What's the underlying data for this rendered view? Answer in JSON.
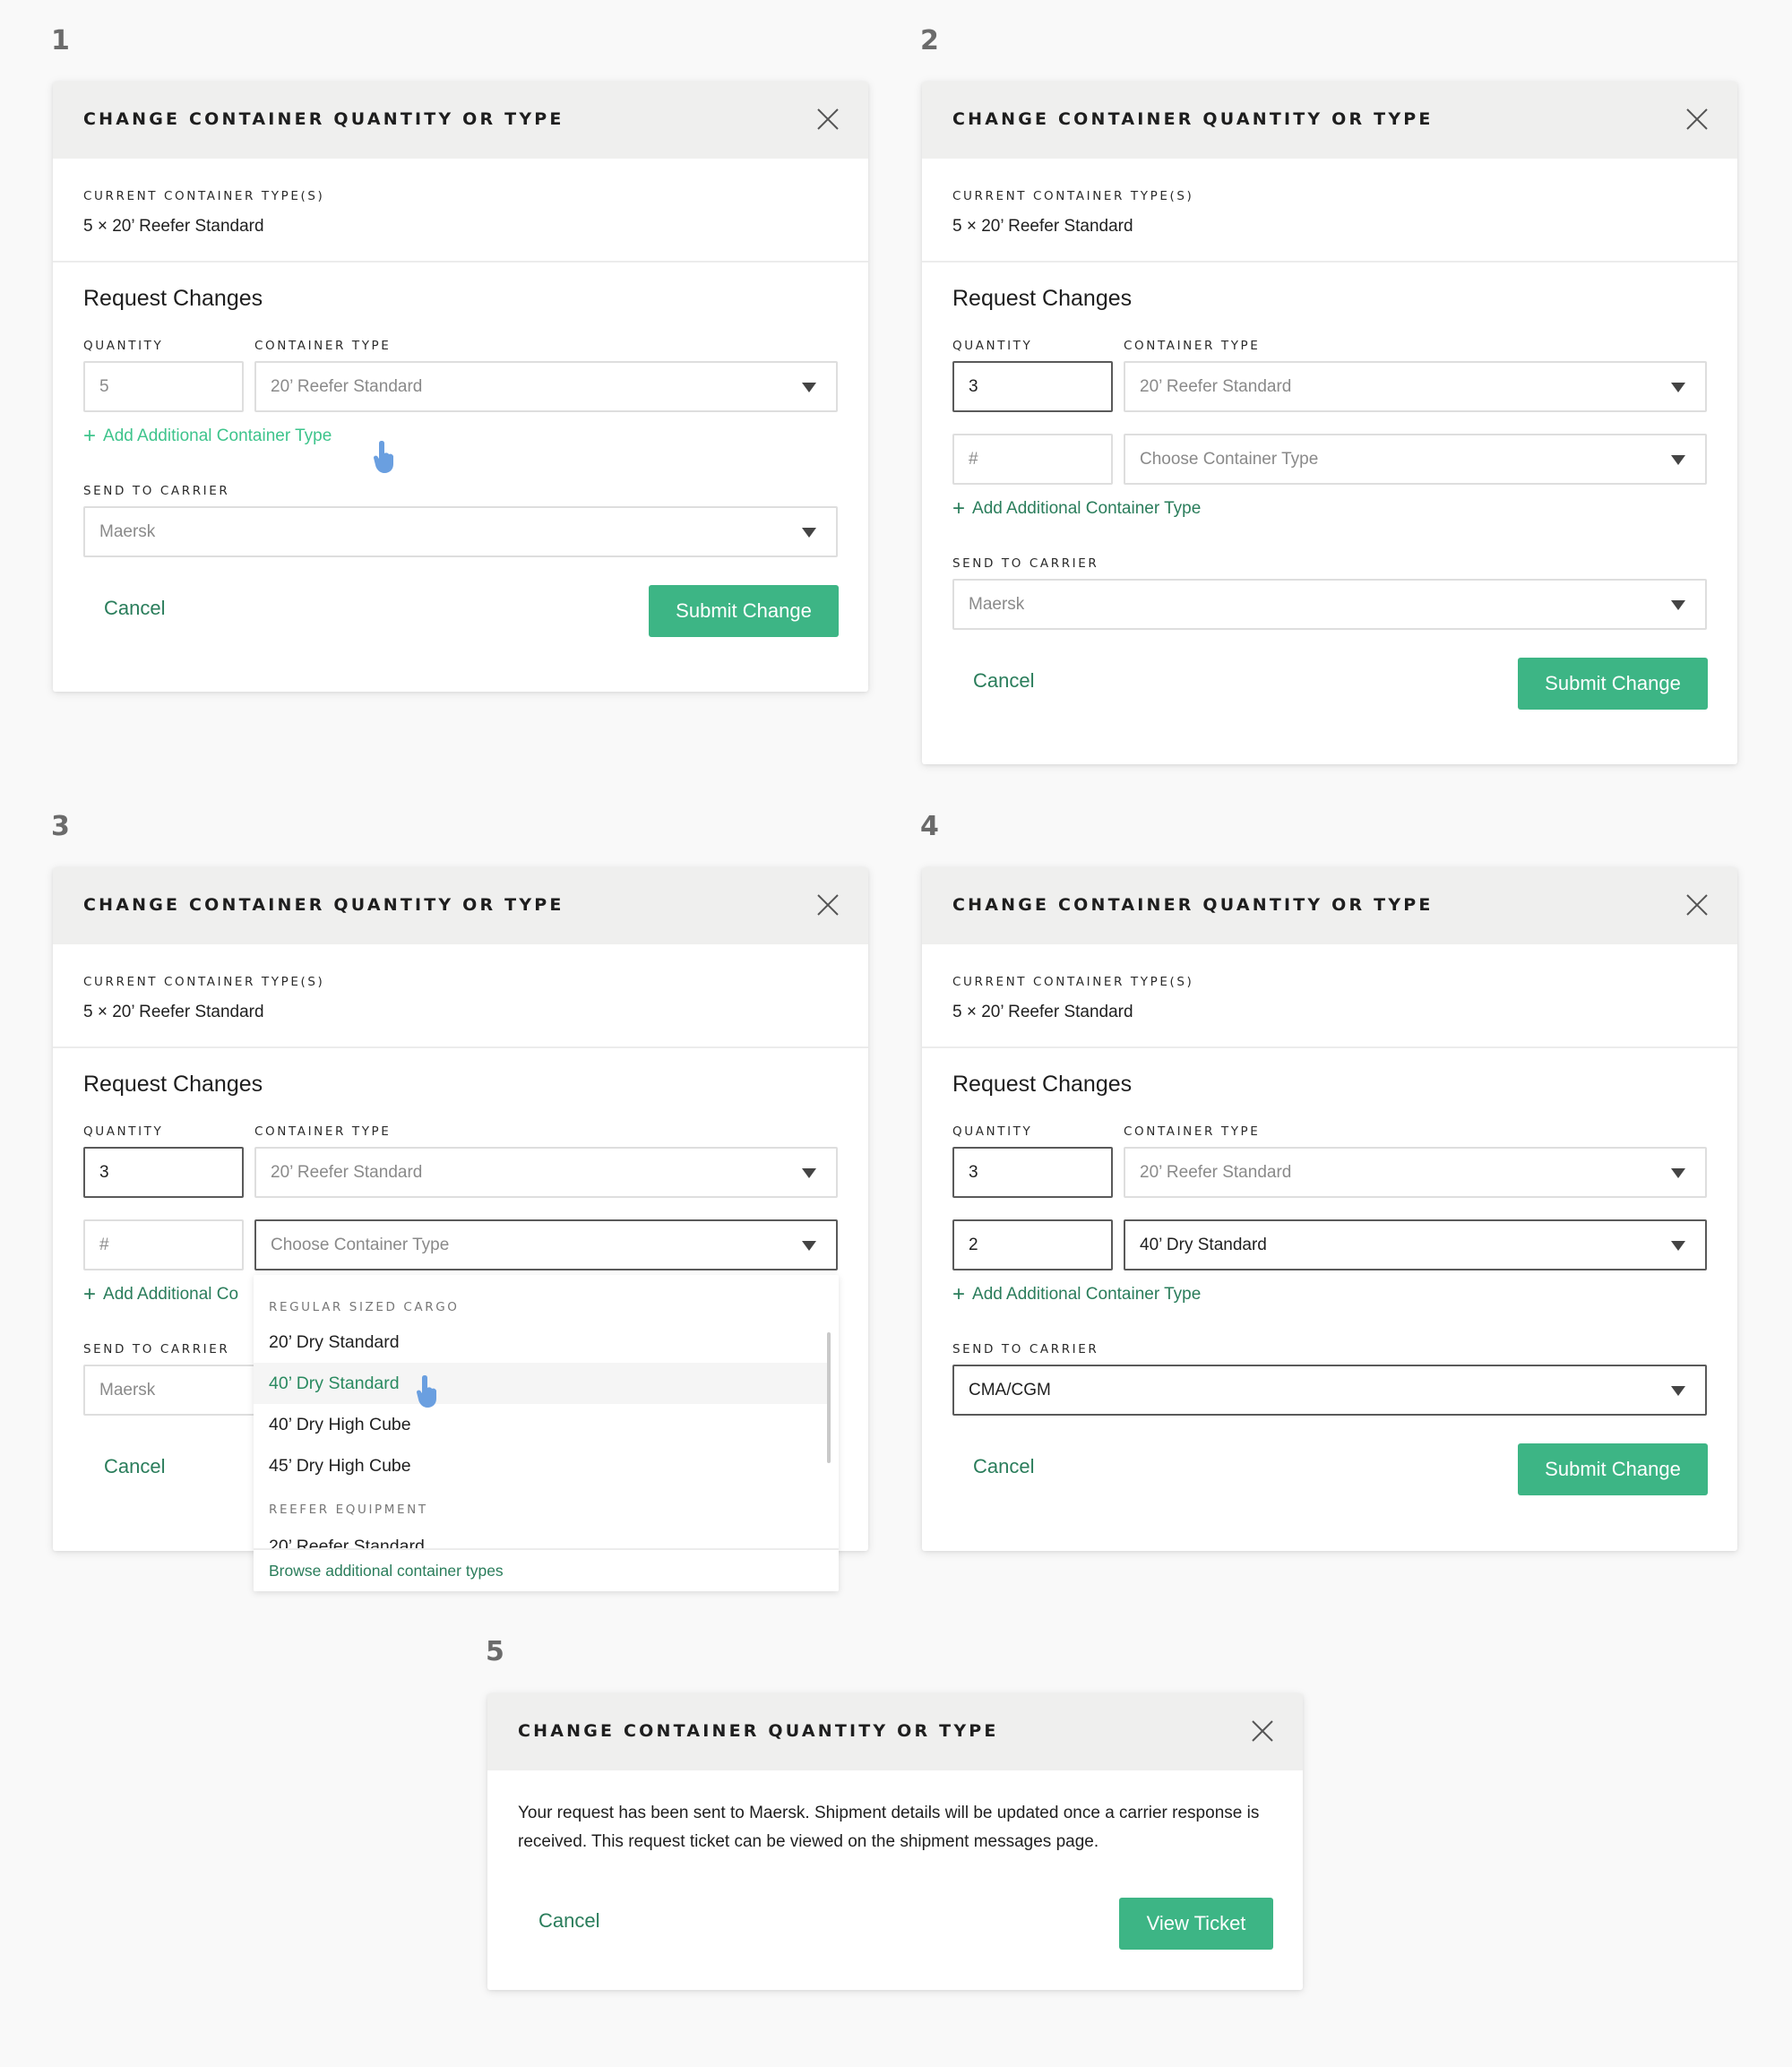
{
  "steps": [
    "1",
    "2",
    "3",
    "4",
    "5"
  ],
  "modal_title": "CHANGE CONTAINER QUANTITY OR TYPE",
  "current_label": "CURRENT CONTAINER TYPE(S)",
  "current_value": "5 × 20’ Reefer Standard",
  "request_title": "Request Changes",
  "quantity_label": "QUANTITY",
  "container_type_label": "CONTAINER TYPE",
  "send_to_carrier_label": "SEND TO CARRIER",
  "add_link_label": "Add Additional Container Type",
  "add_link_truncated": "Add Additional Co",
  "quantity_placeholder": "#",
  "container_type_placeholder": "Choose Container Type",
  "cancel_label": "Cancel",
  "submit_label": "Submit Change",
  "view_ticket_label": "View Ticket",
  "colors": {
    "accent": "#3db585",
    "link": "#2a7d5b",
    "link_hover": "#3ec48c",
    "header_bg": "#efefee",
    "cursor": "#6a9fe0"
  },
  "panel1": {
    "qty": "5",
    "type": "20’ Reefer Standard",
    "carrier": "Maersk"
  },
  "panel2": {
    "qty1": "3",
    "type1": "20’ Reefer Standard",
    "carrier": "Maersk"
  },
  "panel3": {
    "qty1": "3",
    "type1": "20’ Reefer Standard",
    "carrier": "Maersk",
    "dropdown": {
      "groups": [
        {
          "label": "REGULAR SIZED CARGO",
          "items": [
            "20’ Dry Standard",
            "40’ Dry Standard",
            "40’ Dry High Cube",
            "45’ Dry High Cube"
          ]
        },
        {
          "label": "REEFER EQUIPMENT",
          "items": [
            "20’ Reefer Standard"
          ]
        }
      ],
      "hovered_item": "40’ Dry Standard",
      "footer_link": "Browse additional container types"
    }
  },
  "panel4": {
    "qty1": "3",
    "type1": "20’ Reefer Standard",
    "qty2": "2",
    "type2": "40’ Dry Standard",
    "carrier": "CMA/CGM"
  },
  "panel5": {
    "message": "Your request has been sent to Maersk. Shipment details will be updated once a carrier response is received. This request ticket can be viewed on the shipment messages page."
  }
}
